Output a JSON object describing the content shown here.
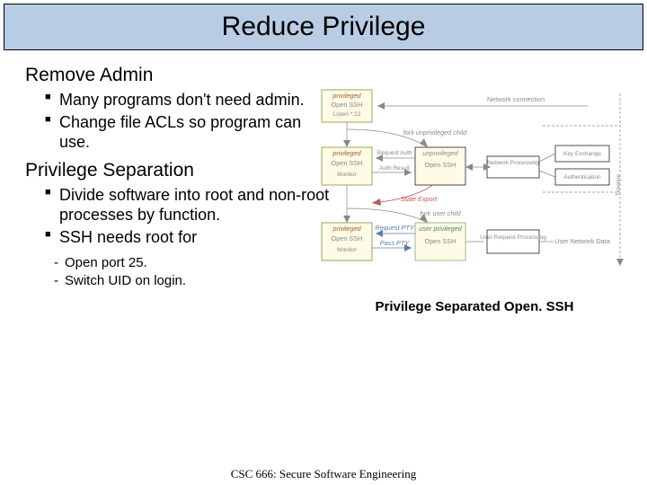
{
  "title": "Reduce Privilege",
  "section1": {
    "heading": "Remove Admin",
    "bullets": [
      "Many programs don't need admin.",
      "Change file ACLs so program can use."
    ]
  },
  "section2": {
    "heading": "Privilege Separation",
    "bullets": [
      "Divide software into root and non-root processes by function.",
      "SSH needs root for"
    ],
    "subbullets": [
      "Open port 25.",
      "Switch UID on login."
    ]
  },
  "caption": "Privilege Separated Open. SSH",
  "footer": "CSC 666: Secure Software Engineering",
  "diagram": {
    "row1": {
      "box1": {
        "top": "privileged",
        "mid": "Open SSH",
        "bot": "Listen *:22"
      },
      "netlabel": "Network connection"
    },
    "fork1": "fork unprivileged child",
    "row2": {
      "box_priv": {
        "top": "privileged",
        "mid": "Open SSH",
        "bot": "Monitor"
      },
      "box_unpriv": {
        "top": "unprivileged",
        "mid": "Open SSH",
        "bot": ""
      },
      "link_top": "Request Auth",
      "link_bot": "Auth Result",
      "net1": "Network Processing",
      "net2": "Key Exchange",
      "net3": "Authentication"
    },
    "stateexport": "State Export",
    "fork2": "fork user child",
    "row3": {
      "box_priv": {
        "top": "privileged",
        "mid": "Open SSH",
        "bot": "Monitor"
      },
      "box_user": {
        "top": "user privileged",
        "mid": "Open SSH",
        "bot": ""
      },
      "link_top": "Request PTY",
      "link_bot": "Pass PTY",
      "net1": "User Request Processing",
      "net2": "User Network Data"
    },
    "timeline": "Timeline"
  }
}
